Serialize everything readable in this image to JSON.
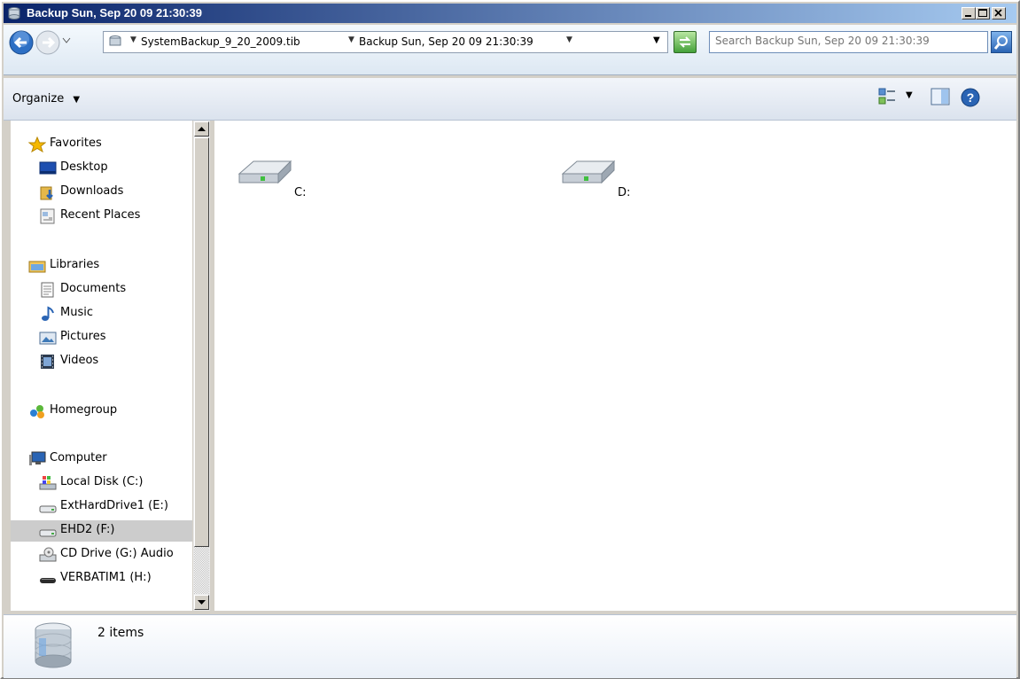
{
  "window": {
    "title": "Backup Sun, Sep 20 09 21:30:39"
  },
  "address_bar": {
    "crumbs": [
      "SystemBackup_9_20_2009.tib",
      "Backup Sun, Sep 20 09 21:30:39"
    ],
    "search_placeholder": "Search Backup Sun, Sep 20 09 21:30:39"
  },
  "toolbar": {
    "organize_label": "Organize"
  },
  "sidebar": {
    "favorites": {
      "label": "Favorites",
      "items": [
        "Desktop",
        "Downloads",
        "Recent Places"
      ]
    },
    "libraries": {
      "label": "Libraries",
      "items": [
        "Documents",
        "Music",
        "Pictures",
        "Videos"
      ]
    },
    "homegroup": {
      "label": "Homegroup"
    },
    "computer": {
      "label": "Computer",
      "items": [
        "Local Disk (C:)",
        "ExtHardDrive1 (E:)",
        "EHD2 (F:)",
        "CD Drive (G:) Audio",
        "VERBATIM1 (H:)"
      ],
      "selected": "EHD2 (F:)"
    }
  },
  "content": {
    "drives": [
      "C:",
      "D:"
    ]
  },
  "details": {
    "item_count": "2 items"
  },
  "colors": {
    "title_start": "#0a246a",
    "title_end": "#a6caf0",
    "selection": "#cccccc"
  }
}
